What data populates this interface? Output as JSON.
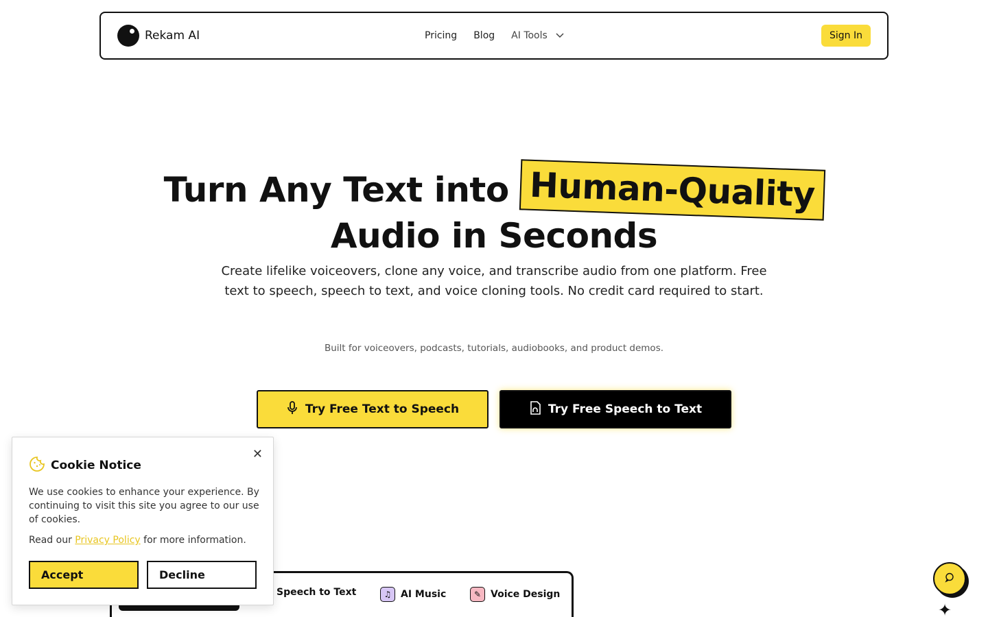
{
  "nav": {
    "brand": "Rekam AI",
    "links": [
      "Pricing",
      "Blog",
      "AI Tools"
    ],
    "sign_in": "Sign In"
  },
  "hero": {
    "title_part1": "Turn Any Text into",
    "title_highlight": "Human-Quality",
    "title_part2": "Audio in Seconds",
    "subtitle": "Create lifelike voiceovers, clone any voice, and transcribe audio from one platform. Free text to speech, speech to text, and voice cloning tools. No credit card required to start.",
    "small": "Built for voiceovers, podcasts, tutorials, audiobooks, and product demos.",
    "cta_primary": "Try Free Text to Speech",
    "cta_secondary": "Try Free Speech to Text"
  },
  "tools": {
    "tabs": [
      "Speech to Text",
      "AI Music",
      "Voice Design"
    ]
  },
  "cookie": {
    "title": "Cookie Notice",
    "body": "We use cookies to enhance your experience. By continuing to visit this site you agree to our use of cookies.",
    "read_prefix": "Read our ",
    "privacy_link": "Privacy Policy",
    "read_suffix": " for more information.",
    "accept": "Accept",
    "decline": "Decline"
  },
  "colors": {
    "accent": "#fadc3a",
    "dark": "#111111"
  }
}
